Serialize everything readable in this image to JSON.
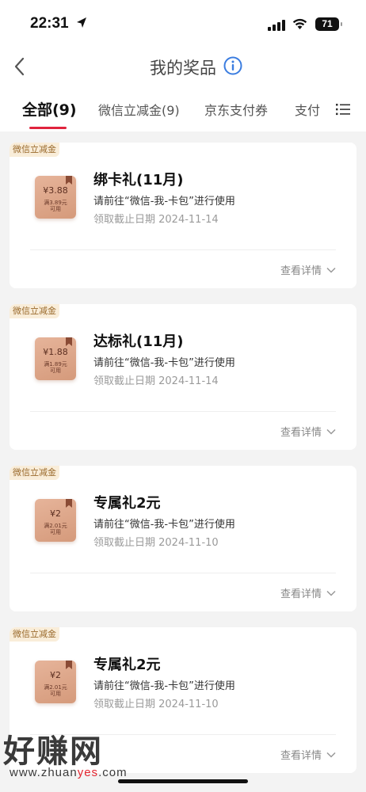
{
  "status": {
    "time": "22:31",
    "battery": "71"
  },
  "nav": {
    "title": "我的奖品"
  },
  "tabs": [
    {
      "label": "全部(9)"
    },
    {
      "label": "微信立减金(9)"
    },
    {
      "label": "京东支付券"
    },
    {
      "label": "支付"
    }
  ],
  "cards": [
    {
      "tag": "微信立减金",
      "amount": "¥3.88",
      "cond_line1": "满3.89元",
      "cond_line2": "可用",
      "title": "绑卡礼(11月)",
      "desc": "请前往“微信-我-卡包”进行使用",
      "date": "领取截止日期 2024-11-14",
      "detail": "查看详情"
    },
    {
      "tag": "微信立减金",
      "amount": "¥1.88",
      "cond_line1": "满1.89元",
      "cond_line2": "可用",
      "title": "达标礼(11月)",
      "desc": "请前往“微信-我-卡包”进行使用",
      "date": "领取截止日期 2024-11-14",
      "detail": "查看详情"
    },
    {
      "tag": "微信立减金",
      "amount": "¥2",
      "cond_line1": "满2.01元",
      "cond_line2": "可用",
      "title": "专属礼2元",
      "desc": "请前往“微信-我-卡包”进行使用",
      "date": "领取截止日期 2024-11-10",
      "detail": "查看详情"
    },
    {
      "tag": "微信立减金",
      "amount": "¥2",
      "cond_line1": "满2.01元",
      "cond_line2": "可用",
      "title": "专属礼2元",
      "desc": "请前往“微信-我-卡包”进行使用",
      "date": "领取截止日期 2024-11-10",
      "detail": "查看详情"
    }
  ],
  "watermark": {
    "main": "好赚网",
    "url_prefix": "www.zhuan",
    "url_highlight": "yes",
    "url_suffix": ".com"
  },
  "colors": {
    "accent": "#e0233d",
    "info_blue": "#3b7de0",
    "tag_bg": "#f9edd9",
    "tag_text": "#9a6a2c",
    "coupon": "#d59a7b"
  },
  "icons": {
    "back": "chevron-left-icon",
    "info": "info-circle-icon",
    "menu": "list-menu-icon",
    "expand": "chevron-down-icon",
    "bookmark": "bookmark-icon"
  }
}
